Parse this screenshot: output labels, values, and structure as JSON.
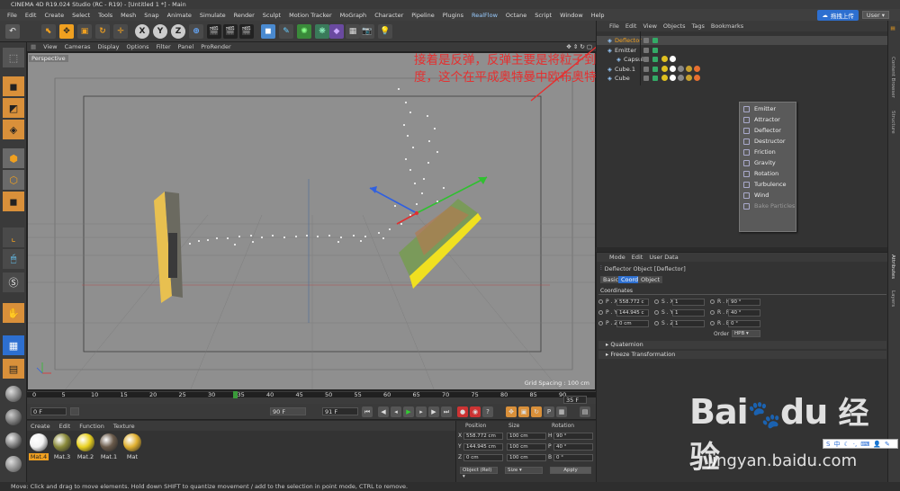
{
  "title": "CINEMA 4D R19.024 Studio (RC - R19) - [Untitled 1 *] - Main",
  "menu": [
    "File",
    "Edit",
    "Create",
    "Select",
    "Tools",
    "Mesh",
    "Snap",
    "Animate",
    "Simulate",
    "Render",
    "Sculpt",
    "Motion Tracker",
    "MoGraph",
    "Character",
    "Pipeline",
    "Plugins",
    "RealFlow",
    "Octane",
    "Script",
    "Window",
    "Help"
  ],
  "topright": {
    "cloud_label": "拖拽上传",
    "layout_value": "User"
  },
  "toolbar": {
    "x_label": "X",
    "y_label": "Y",
    "z_label": "Z"
  },
  "viewport": {
    "menu": [
      "View",
      "Cameras",
      "Display",
      "Options",
      "Filter",
      "Panel",
      "ProRender"
    ],
    "label": "Perspective",
    "grid_spacing": "Grid Spacing : 100 cm"
  },
  "annotation": "接着是反弹，反弹主要是将粒子到点上的时候，点的角度决定了粒子反弹的角度，这个在平成奥特曼中欧布奥特曼对战超级杰顿的时候我们也见到了。",
  "timeline": {
    "ticks": [
      "0",
      "5",
      "10",
      "15",
      "20",
      "25",
      "30",
      "35",
      "40",
      "45",
      "50",
      "55",
      "60",
      "65",
      "70",
      "75",
      "80",
      "85",
      "90"
    ],
    "current": "35 F",
    "end_field": "90 F"
  },
  "playbar": {
    "start": "0 F",
    "min": "0 F",
    "max": "90 F",
    "end": "91 F"
  },
  "materials": {
    "menu": [
      "Create",
      "Edit",
      "Function",
      "Texture"
    ],
    "items": [
      {
        "label": "Mat.4",
        "color": "#f2f2f2"
      },
      {
        "label": "Mat.3",
        "color": "#8a8a3a"
      },
      {
        "label": "Mat.2",
        "color": "#e8d020"
      },
      {
        "label": "Mat.1",
        "color": "#6a5a4a"
      },
      {
        "label": "Mat",
        "color": "#e0b030"
      }
    ]
  },
  "coordinates": {
    "headers": [
      "Position",
      "Size",
      "Rotation"
    ],
    "rows": [
      {
        "axis": "X",
        "pos": "558.772 cm",
        "size": "100 cm",
        "rot_label": "H",
        "rot": "90 °"
      },
      {
        "axis": "Y",
        "pos": "144.945 cm",
        "size": "100 cm",
        "rot_label": "P",
        "rot": "40 °"
      },
      {
        "axis": "Z",
        "pos": "0 cm",
        "size": "100 cm",
        "rot_label": "B",
        "rot": "0 °"
      }
    ],
    "mode1": "Object (Rel)",
    "mode2": "Size",
    "apply": "Apply"
  },
  "status": "Move: Click and drag to move elements. Hold down SHIFT to quantize movement / add to the selection in point mode, CTRL to remove.",
  "object_manager": {
    "menu": [
      "File",
      "Edit",
      "View",
      "Objects",
      "Tags",
      "Bookmarks"
    ],
    "objects": [
      {
        "name": "Deflector",
        "selected": true
      },
      {
        "name": "Emitter",
        "selected": false
      },
      {
        "name": "Capsule",
        "selected": false
      },
      {
        "name": "Cube.1",
        "selected": false
      },
      {
        "name": "Cube",
        "selected": false
      }
    ]
  },
  "popup_menu": [
    "Emitter",
    "Attractor",
    "Deflector",
    "Destructor",
    "Friction",
    "Gravity",
    "Rotation",
    "Turbulence",
    "Wind",
    "Bake Particles"
  ],
  "attributes": {
    "menu": [
      "Mode",
      "Edit",
      "User Data"
    ],
    "object_title": "Deflector Object [Deflector]",
    "tabs": [
      "Basic",
      "Coord.",
      "Object"
    ],
    "section": "Coordinates",
    "p_labels": [
      "P . X",
      "P . Y",
      "P . Z"
    ],
    "p_vals": [
      "558.772 c",
      "144.945 c",
      "0 cm"
    ],
    "s_labels": [
      "S . X",
      "S . Y",
      "S . Z"
    ],
    "s_vals": [
      "1",
      "1",
      "1"
    ],
    "r_labels": [
      "R . H",
      "R . P",
      "R . B"
    ],
    "r_vals": [
      "90 °",
      "40 °",
      "0 °"
    ],
    "order_label": "Order",
    "order_value": "HPB",
    "collapsed": [
      "Quaternion",
      "Freeze Transformation"
    ]
  },
  "right_strip": [
    "Content Browser",
    "Structure",
    "Attributes",
    "Layers"
  ],
  "watermark": {
    "brand": "Bai",
    "brand2": "du",
    "cn": "经验",
    "url": "jingyan.baidu.com"
  },
  "ime": {
    "label": "中"
  }
}
